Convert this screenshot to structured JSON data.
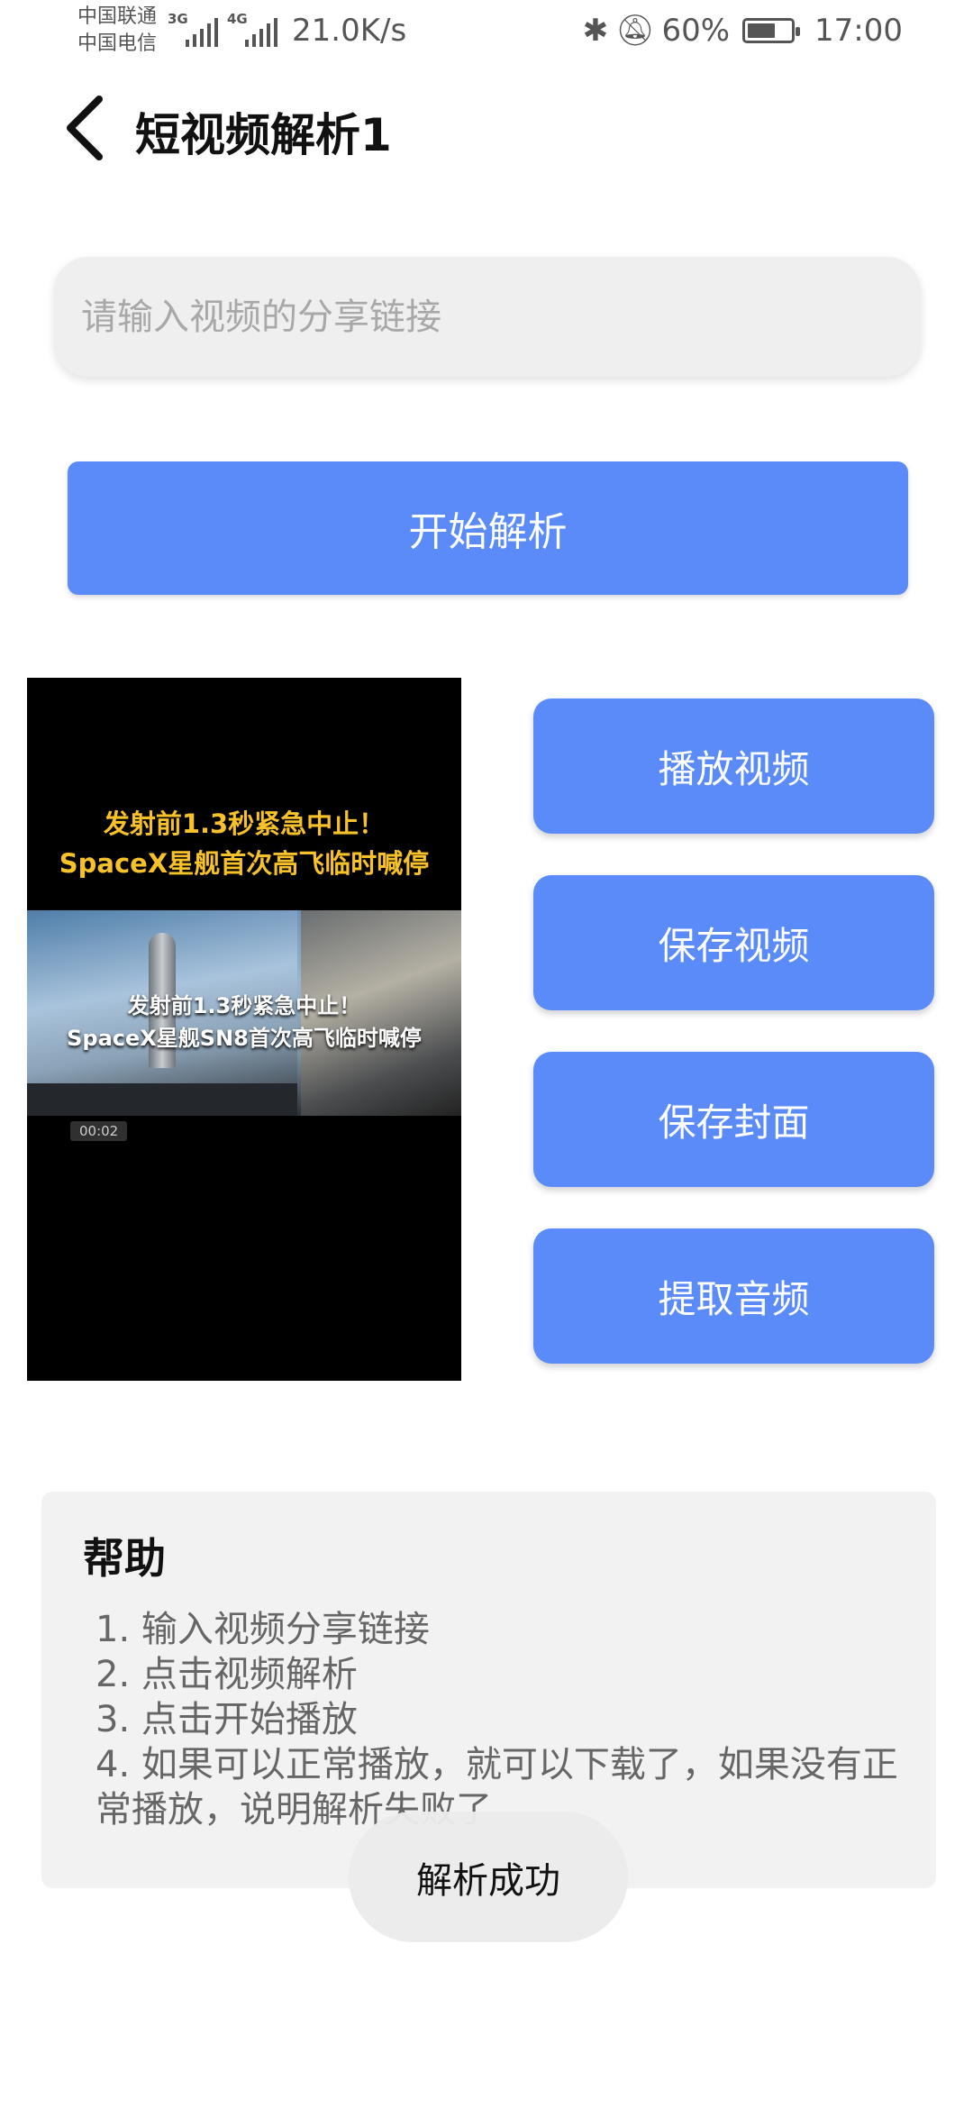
{
  "status_bar": {
    "carrier_1": "中国联通",
    "carrier_2": "中国电信",
    "net_1": "3G",
    "net_2": "4G",
    "speed": "21.0K/s",
    "battery": "60%",
    "time": "17:00",
    "battery_level": 0.6
  },
  "header": {
    "title": "短视频解析1",
    "back_icon": "chevron-left-icon"
  },
  "input": {
    "placeholder": "请输入视频的分享链接",
    "value": ""
  },
  "parse_button": "开始解析",
  "video": {
    "caption_line1": "发射前1.3秒紧急中止！",
    "caption_line2": "SpaceX星舰首次高飞临时喊停",
    "overlay_line1": "发射前1.3秒紧急中止！",
    "overlay_line2": "SpaceX星舰SN8首次高飞临时喊停",
    "timestamp": "00:02"
  },
  "actions": [
    {
      "label": "播放视频"
    },
    {
      "label": "保存视频"
    },
    {
      "label": "保存封面"
    },
    {
      "label": "提取音频"
    }
  ],
  "help": {
    "title": "帮助",
    "items": [
      "1. 输入视频分享链接",
      "2. 点击视频解析",
      "3. 点击开始播放",
      "4. 如果可以正常播放，就可以下载了，如果没有正常播放，说明解析失败了"
    ]
  },
  "toast": "解析成功",
  "colors": {
    "accent": "#5a8bf8",
    "card_bg": "#f2f2f2",
    "input_bg": "#efefef"
  }
}
